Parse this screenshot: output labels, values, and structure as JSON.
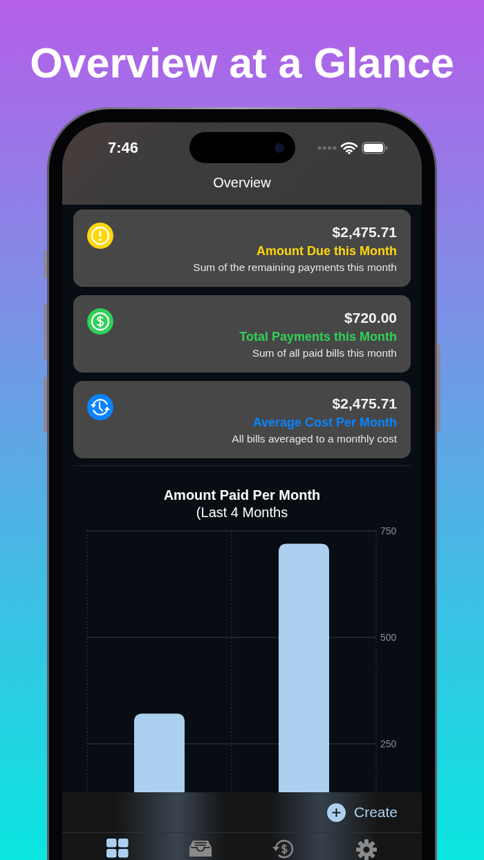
{
  "headline": "Overview at a Glance",
  "status_bar": {
    "time": "7:46"
  },
  "nav": {
    "title": "Overview"
  },
  "cards": [
    {
      "kind": "due",
      "value": "$2,475.71",
      "label": "Amount Due this Month",
      "description": "Sum of the remaining payments this month",
      "color": "#ffd60a"
    },
    {
      "kind": "paid",
      "value": "$720.00",
      "label": "Total Payments this Month",
      "description": "Sum of all paid bills this month",
      "color": "#30d158"
    },
    {
      "kind": "average",
      "value": "$2,475.71",
      "label": "Average Cost Per Month",
      "description": "All bills averaged to a monthly cost",
      "color": "#0a84ff"
    }
  ],
  "chart": {
    "title": "Amount Paid Per Month",
    "subtitle": "(Last 4 Months",
    "chart_data": {
      "type": "bar",
      "values": [
        321,
        720
      ],
      "ylim": [
        0,
        750
      ],
      "yticks": [
        250,
        500,
        750
      ]
    }
  },
  "create_button": {
    "label": "Create"
  },
  "tabs": [
    {
      "selected": true
    },
    {
      "selected": false
    },
    {
      "selected": false
    },
    {
      "selected": false
    }
  ]
}
